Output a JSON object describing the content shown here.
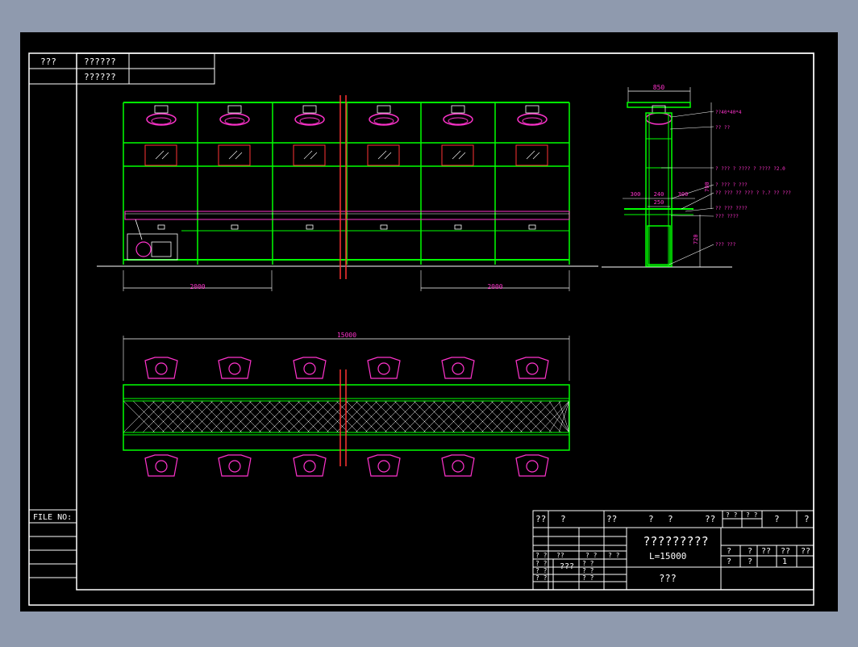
{
  "colors": {
    "background": "#8f9aae",
    "sheet": "#000000",
    "border": "#ffffff",
    "frame": "#00ff00",
    "text": "#ffffff",
    "dimension": "#ff33cc",
    "cut_line": "#ff3333"
  },
  "left_table": {
    "row1_label": "???",
    "row1_value": "??????",
    "row2_value": "??????"
  },
  "file_no": "FILE NO:",
  "elevation": {
    "dim_left": "2000",
    "dim_right": "2000"
  },
  "plan": {
    "dim_total": "15000"
  },
  "side_view": {
    "dim_top": "850",
    "dim_300_left": "300",
    "dim_240": "240",
    "dim_300_right": "300",
    "dim_250": "250",
    "dim_700": "700",
    "dim_720": "720",
    "notes": [
      "??40*40*4",
      "?? ??",
      "? ??? ? ???? ? ???? ?2.0",
      "? ??? ? ???",
      "?? ??? ?? ??? ? ?.? ?? ???",
      "?? ??? ????",
      "??? ????",
      "??? ???"
    ]
  },
  "title_block": {
    "header": [
      "??",
      "?",
      "??",
      "?",
      "?",
      "??",
      "? ?",
      "? ?",
      "?",
      "?"
    ],
    "title": "?????????",
    "subtitle": "L=15000",
    "company": "???",
    "rev_labels": [
      "?",
      "?",
      "??",
      "??",
      "??"
    ],
    "sheet_labels": [
      "?",
      "?"
    ],
    "sheet_value": "1",
    "sign_rows": [
      [
        "? ?",
        "??",
        "? ?",
        "? ?"
      ],
      [
        "? ?",
        "???",
        "? ?"
      ],
      [
        "? ?",
        "? ?"
      ],
      [
        "? ?",
        "? ?"
      ]
    ]
  }
}
